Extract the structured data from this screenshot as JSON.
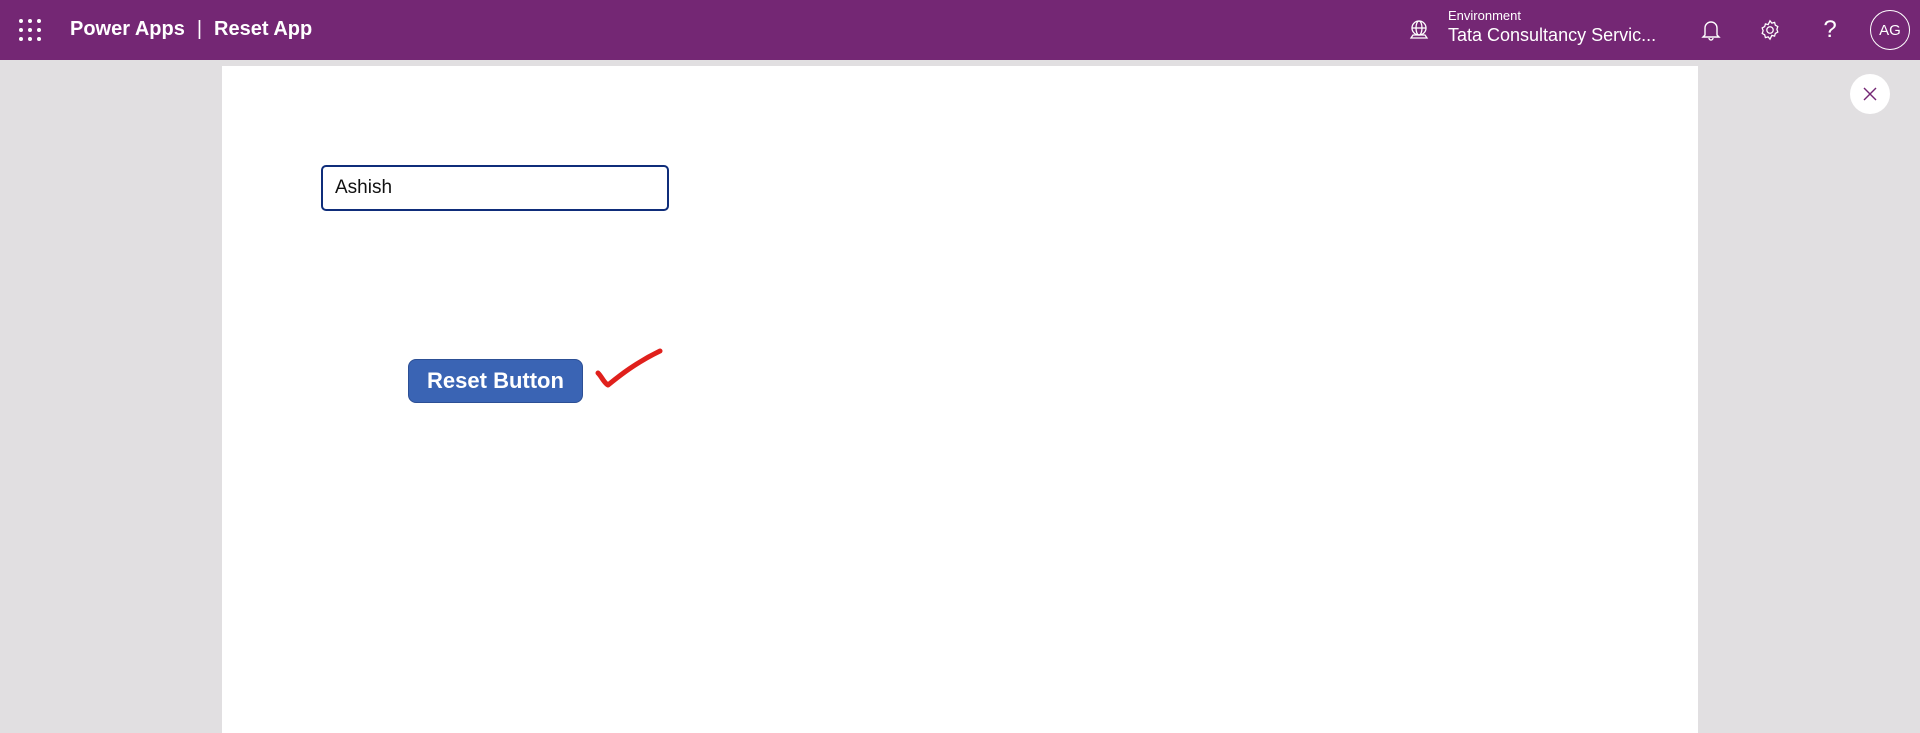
{
  "header": {
    "app_name": "Power Apps",
    "separator": "|",
    "app_title": "Reset App",
    "environment_label": "Environment",
    "environment_name": "Tata Consultancy Servic...",
    "avatar_initials": "AG",
    "help_glyph": "?",
    "icons": [
      "waffle-icon",
      "globe-icon",
      "bell-icon",
      "gear-icon",
      "help-icon",
      "close-icon"
    ]
  },
  "app": {
    "text_input_value": "Ashish",
    "reset_button_label": "Reset Button",
    "annotation_color": "#e0201c"
  },
  "colors": {
    "header": "#742774",
    "button": "#3a64b4",
    "input_border": "#0f2d7a"
  }
}
